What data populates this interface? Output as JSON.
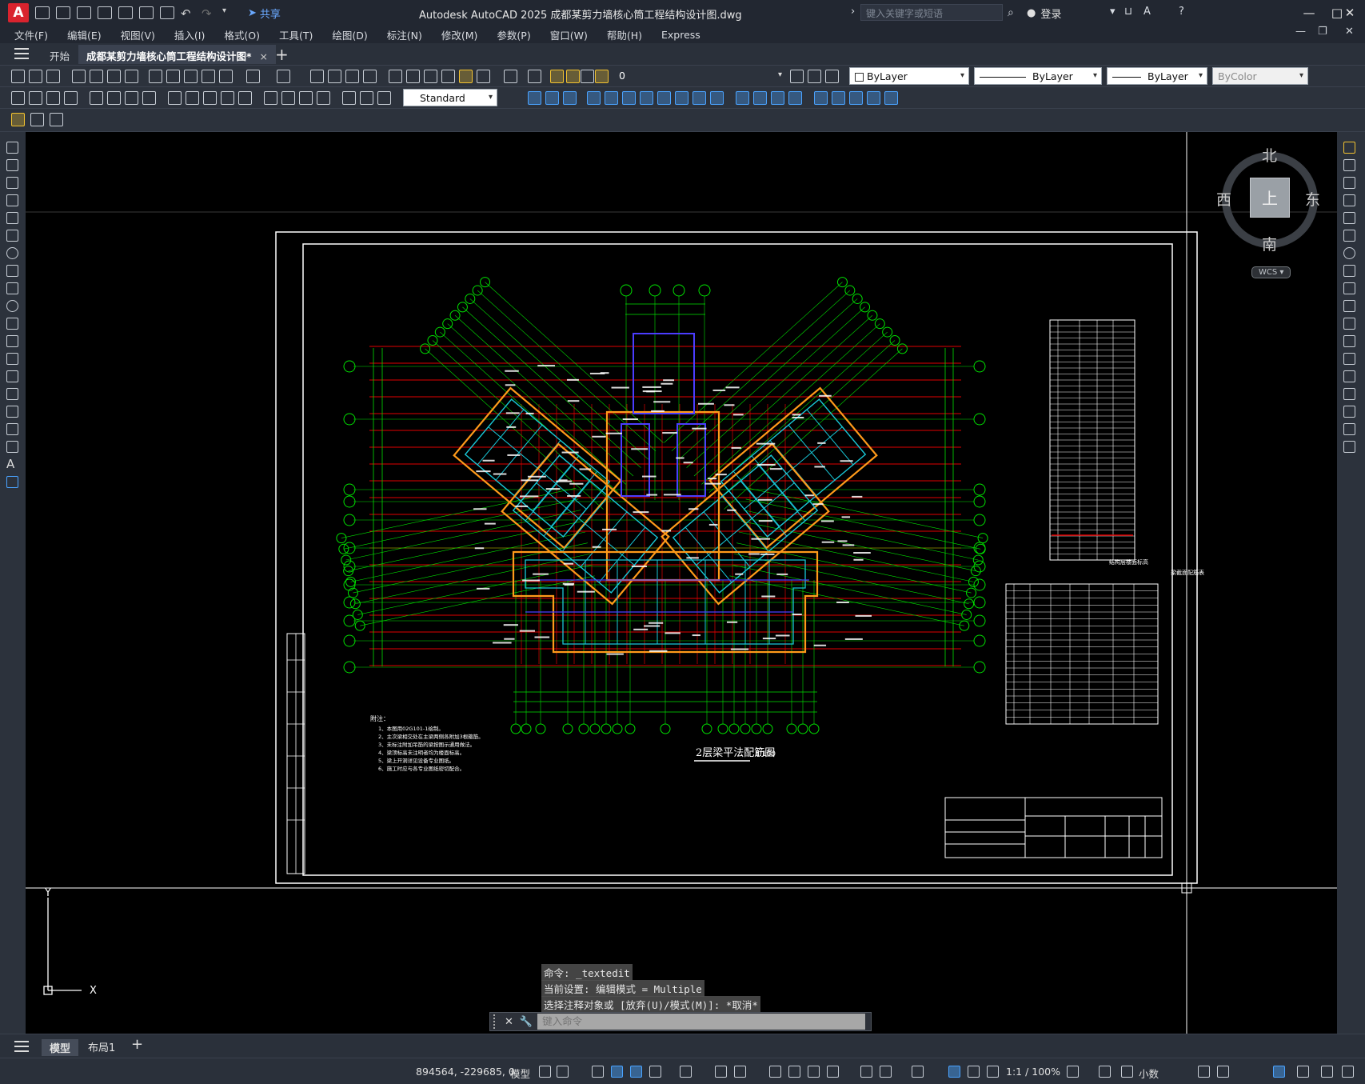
{
  "app": {
    "logo": "A",
    "title": "Autodesk AutoCAD 2025    成都某剪力墙核心筒工程结构设计图.dwg"
  },
  "quick_access": {
    "share_label": "共享",
    "icons": [
      "new-icon",
      "open-icon",
      "save-icon",
      "saveas-icon",
      "web-icon",
      "plot-icon",
      "print-icon",
      "undo-icon",
      "redo-icon",
      "customize-icon"
    ]
  },
  "search": {
    "placeholder": "键入关键字或短语"
  },
  "account": {
    "login_label": "登录"
  },
  "menus": [
    "文件(F)",
    "编辑(E)",
    "视图(V)",
    "插入(I)",
    "格式(O)",
    "工具(T)",
    "绘图(D)",
    "标注(N)",
    "修改(M)",
    "参数(P)",
    "窗口(W)",
    "帮助(H)",
    "Express"
  ],
  "tabs": {
    "start": "开始",
    "active": "成都某剪力墙核心筒工程结构设计图*",
    "close": "×",
    "add": "+"
  },
  "properties": {
    "layer": "0",
    "text_style": "Standard",
    "color": "ByLayer",
    "linetype": "ByLayer",
    "lineweight": "ByLayer",
    "plotstyle": "ByColor"
  },
  "viewcube": {
    "north": "北",
    "south": "南",
    "east": "东",
    "west": "西",
    "face": "上",
    "wcs": "WCS"
  },
  "drawing": {
    "plan_title": "2层梁平法配筋图",
    "plan_scale": "1:100",
    "notes_heading": "附注：",
    "notes": [
      "1、本图用02G101-1绘制。",
      "2、主次梁相交处在主梁两侧各附加3根箍筋。",
      "3、未标注附加吊筋的梁按图示通用做法。",
      "4、梁顶标高未注明者均为楼面标高。",
      "5、梁上开洞详见设备专业图纸。",
      "6、施工时应与各专业图纸密切配合。"
    ],
    "table_title": "结构层楼面标高",
    "table2_title": "梁截面配筋表"
  },
  "command": {
    "history": [
      "命令: _textedit",
      "当前设置: 编辑模式 = Multiple",
      "选择注释对象或 [放弃(U)/模式(M)]: *取消*"
    ],
    "placeholder": "键入命令"
  },
  "layouts": [
    "模型",
    "布局1"
  ],
  "status": {
    "coords": "894564, -229685, 0",
    "space": "模型",
    "scale": "1:1 / 100%",
    "units": "小数"
  },
  "colors": {
    "axis_green": "#00e000",
    "beam_red": "#e00000",
    "wall_orange": "#ff9a1a",
    "wall_cyan": "#18c8d8",
    "wall_blue": "#4b3cff",
    "text_white": "#ffffff"
  }
}
